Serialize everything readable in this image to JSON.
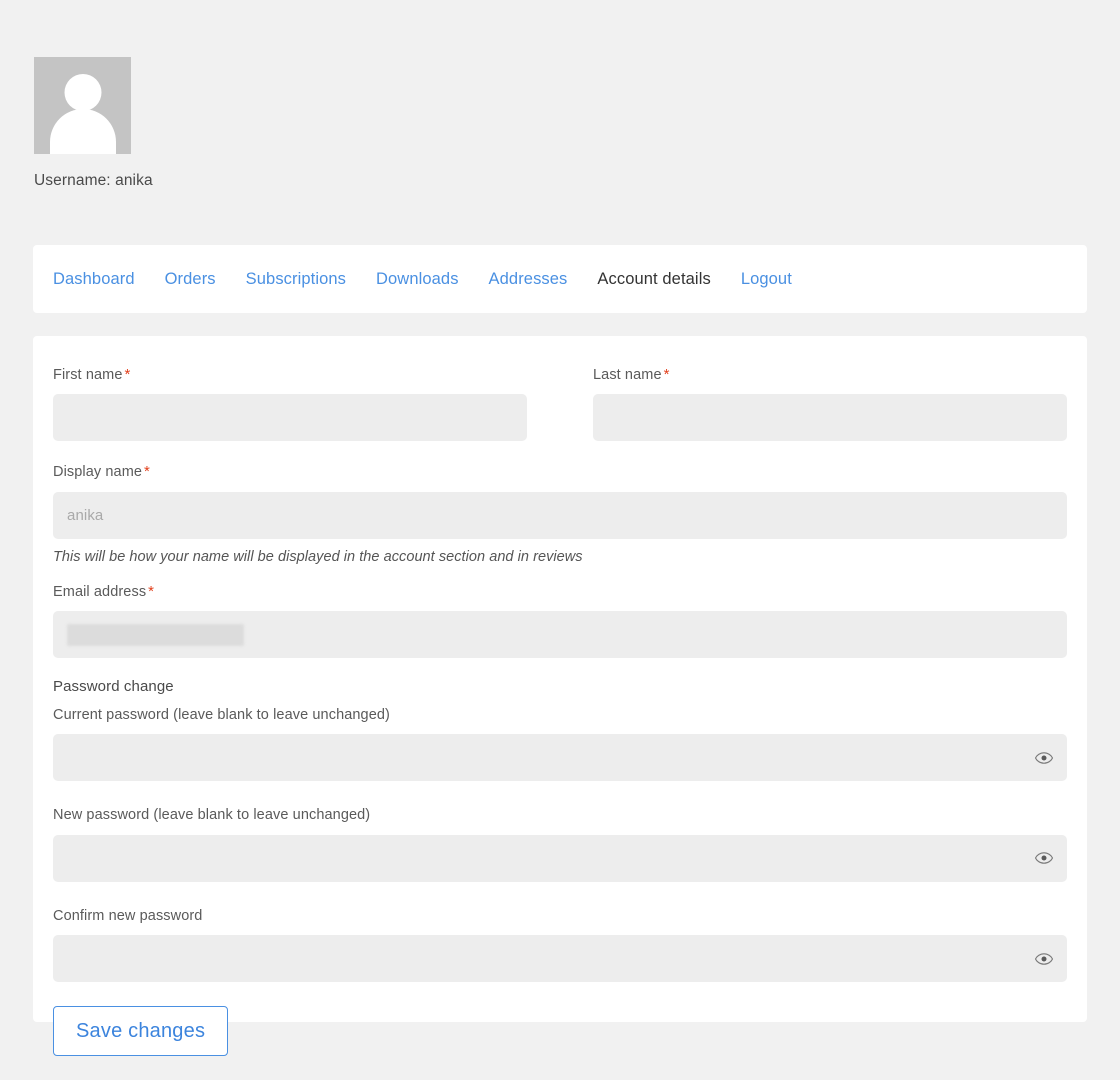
{
  "account": {
    "avatar_icon": "user-avatar-placeholder-icon",
    "username_line": "Username: anika"
  },
  "nav": {
    "items": [
      {
        "label": "Dashboard",
        "active": false
      },
      {
        "label": "Orders",
        "active": false
      },
      {
        "label": "Subscriptions",
        "active": false
      },
      {
        "label": "Downloads",
        "active": false
      },
      {
        "label": "Addresses",
        "active": false
      },
      {
        "label": "Account details",
        "active": true
      },
      {
        "label": "Logout",
        "active": false
      }
    ]
  },
  "form": {
    "first_name": {
      "label": "First name",
      "required_marker": "*",
      "value": "",
      "placeholder": ""
    },
    "last_name": {
      "label": "Last name",
      "required_marker": "*",
      "value": "",
      "placeholder": ""
    },
    "display_name": {
      "label": "Display name",
      "required_marker": "*",
      "value": "anika",
      "help": "This will be how your name will be displayed in the account section and in reviews"
    },
    "email": {
      "label": "Email address",
      "required_marker": "*",
      "value": "",
      "redacted": true
    },
    "password_section_heading": "Password change",
    "current_password": {
      "label": "Current password (leave blank to leave unchanged)",
      "value": "",
      "toggle_icon": "eye-icon"
    },
    "new_password": {
      "label": "New password (leave blank to leave unchanged)",
      "value": "",
      "toggle_icon": "eye-icon"
    },
    "confirm_password": {
      "label": "Confirm new password",
      "value": "",
      "toggle_icon": "eye-icon"
    },
    "save_label": "Save changes"
  },
  "colors": {
    "page_background": "#f1f1f1",
    "card_background": "#ffffff",
    "link_blue": "#4a90e2",
    "active_tab_text": "#333333",
    "required_red": "#e2401c",
    "input_background": "#ededed",
    "avatar_background": "#c4c4c4"
  }
}
